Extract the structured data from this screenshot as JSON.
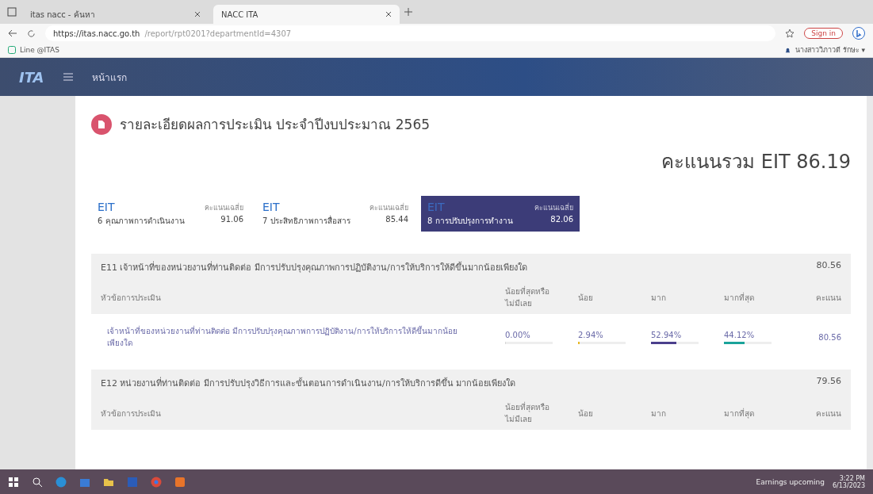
{
  "browser": {
    "tabs": [
      {
        "label": "itas nacc - ค้นหา",
        "selected": false
      },
      {
        "label": "NACC ITA",
        "selected": true
      }
    ],
    "url_host": "https://itas.nacc.go.th",
    "url_path": "/report/rpt0201?departmentId=4307",
    "sign_in": "Sign in",
    "bookmark": "Line @ITAS",
    "user": "นางสาววิภาวดี รักษะ ▾"
  },
  "nav": {
    "logo": "ITA",
    "home": "หน้าแรก"
  },
  "page": {
    "title": "รายละเอียดผลการประเมิน ประจำปีงบประมาณ 2565",
    "total": "คะแนนรวม EIT 86.19"
  },
  "tabs": [
    {
      "code": "EIT",
      "avg_label": "คะแนนเฉลี่ย",
      "name": "6 คุณภาพการดำเนินงาน",
      "score": "91.06",
      "selected": false
    },
    {
      "code": "EIT",
      "avg_label": "คะแนนเฉลี่ย",
      "name": "7 ประสิทธิภาพการสื่อสาร",
      "score": "85.44",
      "selected": false
    },
    {
      "code": "EIT",
      "avg_label": "คะแนนเฉลี่ย",
      "name": "8 การปรับปรุงการทำงาน",
      "score": "82.06",
      "selected": true
    }
  ],
  "sections": [
    {
      "title": "E11 เจ้าหน้าที่ของหน่วยงานที่ท่านติดต่อ มีการปรับปรุงคุณภาพการปฏิบัติงาน/การให้บริการให้ดีขึ้นมากน้อยเพียงใด",
      "score": "80.56",
      "columns": [
        "หัวข้อการประเมิน",
        "น้อยที่สุดหรือไม่มีเลย",
        "น้อย",
        "มาก",
        "มากที่สุด",
        "คะแนน"
      ],
      "rows": [
        {
          "cells": [
            {
              "text": "เจ้าหน้าที่ของหน่วยงานที่ท่านติดต่อ มีการปรับปรุงคุณภาพการปฏิบัติงาน/การให้บริการให้ดีขึ้นมากน้อยเพียงใด"
            },
            {
              "text": "0.00%",
              "level": 0
            },
            {
              "text": "2.94%",
              "level": 0.0294,
              "color": "#e8b923"
            },
            {
              "text": "52.94%",
              "level": 0.5294,
              "color": "#4b3f8c"
            },
            {
              "text": "44.12%",
              "level": 0.4412,
              "color": "#1aa39a"
            },
            {
              "text": "80.56"
            }
          ]
        }
      ]
    },
    {
      "title": "E12 หน่วยงานที่ท่านติดต่อ มีการปรับปรุงวิธีการและขั้นตอนการดำเนินงาน/การให้บริการดีขึ้น มากน้อยเพียงใด",
      "score": "79.56",
      "columns": [
        "หัวข้อการประเมิน",
        "น้อยที่สุดหรือไม่มีเลย",
        "น้อย",
        "มาก",
        "มากที่สุด",
        "คะแนน"
      ]
    }
  ],
  "taskbar": {
    "news": "Earnings upcoming",
    "time": "3:22 PM",
    "date": "6/13/2023"
  }
}
